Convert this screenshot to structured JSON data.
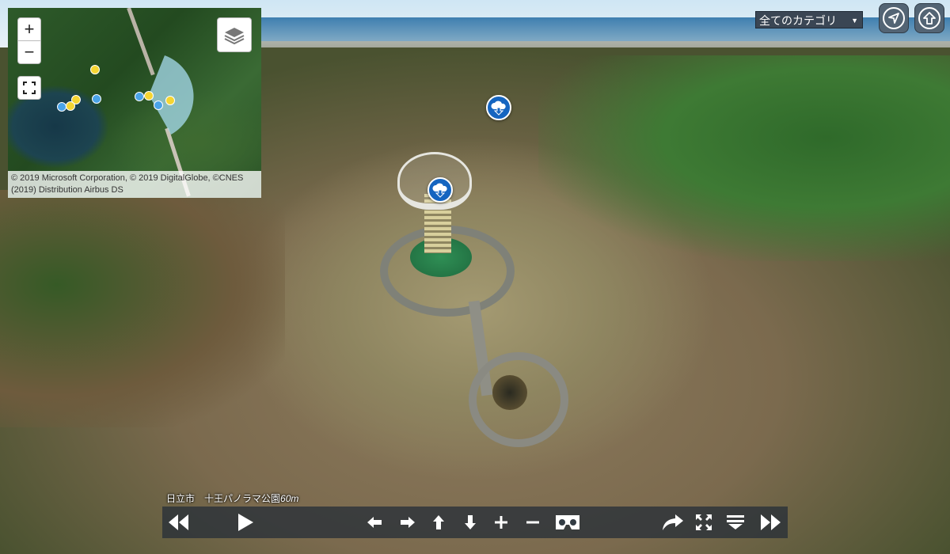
{
  "minimap": {
    "attribution": "© 2019 Microsoft Corporation, © 2019 DigitalGlobe, ©CNES (2019) Distribution Airbus DS",
    "zoom_in_label": "+",
    "zoom_out_label": "−"
  },
  "category_menu": {
    "label": "全てのカテゴリ",
    "arrow": "▼"
  },
  "caption": {
    "location": "日立市　十王パノラマ公園",
    "altitude": "60m"
  },
  "icons": {
    "map_layers": "layers-icon",
    "fullscreen_map": "fullscreen-icon",
    "navigate": "navigation-arrow-icon",
    "home": "home-arrow-icon",
    "hotspot": "cloud-download-icon"
  },
  "colors": {
    "toolbar_bg": "#283038",
    "hotspot": "#1565c0",
    "pin_yellow": "#f5d532",
    "pin_blue": "#4aa3e8"
  }
}
